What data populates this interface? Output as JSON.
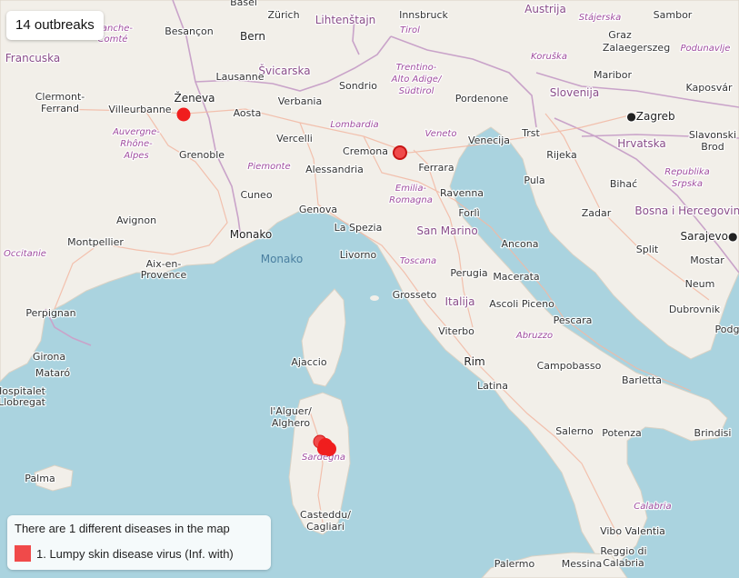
{
  "header": {
    "outbreak_count": "14 outbreaks"
  },
  "legend": {
    "title": "There are 1 different diseases in the map",
    "items": [
      {
        "label": "1. Lumpy skin disease virus (Inf. with)",
        "color": "#f04a4a"
      }
    ]
  },
  "colors": {
    "sea": "#aad3df",
    "land": "#f2efe9",
    "border": "#c9a3c9",
    "road": "#f3b8a3",
    "marker": "#f01e1e"
  },
  "map": {
    "countries": [
      "Francuska",
      "Švicarska",
      "Lihtenštajn",
      "Austrija",
      "Slovenija",
      "Hrvatska",
      "Italija",
      "San Marino",
      "Monako",
      "Bosna i Hercegovina"
    ],
    "seas": [
      "Monako"
    ],
    "regions": [
      "Franche-Comté",
      "Auvergne-Rhône-Alpes",
      "Tirol",
      "Trentino-Alto Adige/Südtirol",
      "Lombardia",
      "Veneto",
      "Piemonte",
      "Emilia-Romagna",
      "Toscana",
      "Abruzzo",
      "Calabria",
      "Sardegna",
      "Stájerska",
      "Koruška",
      "Podunavlje",
      "Republika Srpska",
      "Occitanie"
    ],
    "cities": [
      "Basel",
      "Zürich",
      "Innsbruck",
      "Sambor",
      "Besançon",
      "Bern",
      "Graz",
      "Zalaegerszeg",
      "Lausanne",
      "Sondrio",
      "Maribor",
      "Kaposvár",
      "Clermont-Ferrand",
      "Villeurbanne",
      "Ženeva",
      "Aosta",
      "Verbania",
      "Pordenone",
      "Zagreb",
      "Vercelli",
      "Cremona",
      "Venecija",
      "Trst",
      "Slavonski Brod",
      "Grenoble",
      "Alessandria",
      "Ferrara",
      "Rijeka",
      "Pula",
      "Bihać",
      "Cuneo",
      "Genova",
      "Ravenna",
      "Forlì",
      "Avignon",
      "Zadar",
      "La Spezia",
      "Sarajevo",
      "Montpellier",
      "Monako",
      "Livorno",
      "Ancona",
      "Split",
      "Mostar",
      "Aix-en-Provence",
      "Perugia",
      "Macerata",
      "Grosseto",
      "Ascoli Piceno",
      "Neum",
      "Dubrovnik",
      "Perpignan",
      "Pescara",
      "Podgorica",
      "Viterbo",
      "Girona",
      "Ajaccio",
      "Rim",
      "Mataró",
      "Campobasso",
      "Barletta",
      "L'Hospitalet de Llobregat",
      "Latina",
      "Alguer/Alghero",
      "Salerno",
      "Potenza",
      "Brindisi",
      "Palma",
      "Cagliari",
      "Casteddu/Cagliari",
      "Vibo Valentia",
      "Reggio di Calabria",
      "Palermo",
      "Messina"
    ]
  }
}
